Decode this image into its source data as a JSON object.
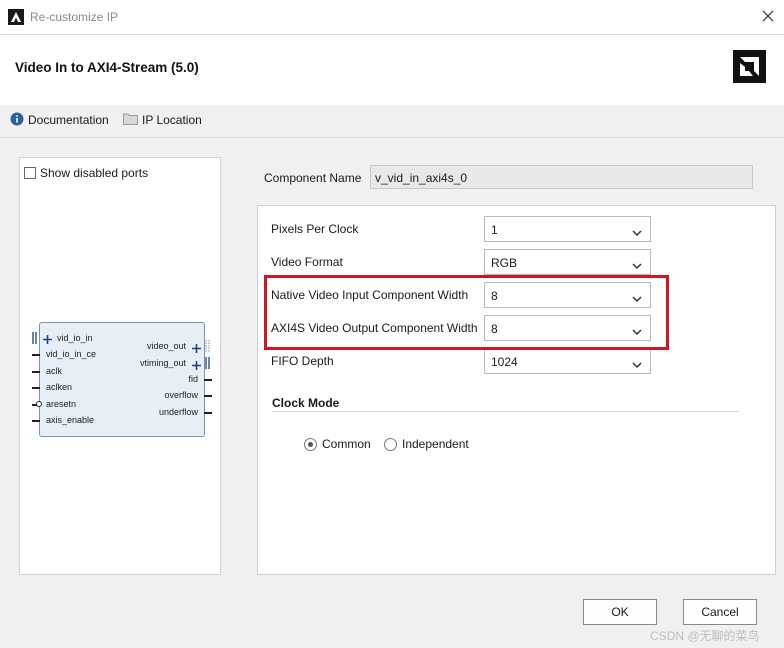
{
  "window": {
    "title": "Re-customize IP",
    "close_symbol": "×"
  },
  "header": {
    "ip_title": "Video In to AXI4-Stream (5.0)"
  },
  "toolbar": {
    "documentation": "Documentation",
    "ip_location": "IP Location"
  },
  "left_panel": {
    "show_disabled_ports": "Show disabled ports",
    "show_disabled_checked": false,
    "block": {
      "left_ports": [
        "vid_io_in",
        "vid_io_in_ce",
        "aclk",
        "aclken",
        "aresetn",
        "axis_enable"
      ],
      "right_ports": [
        "video_out",
        "vtiming_out",
        "fid",
        "overflow",
        "underflow"
      ]
    }
  },
  "component": {
    "label": "Component Name",
    "value": "v_vid_in_axi4s_0"
  },
  "params": [
    {
      "label": "Pixels Per Clock",
      "value": "1"
    },
    {
      "label": "Video Format",
      "value": "RGB"
    },
    {
      "label": "Native Video Input Component Width",
      "value": "8"
    },
    {
      "label": "AXI4S Video Output Component Width",
      "value": "8"
    },
    {
      "label": "FIFO Depth",
      "value": "1024"
    }
  ],
  "clock_mode": {
    "title": "Clock Mode",
    "options": [
      "Common",
      "Independent"
    ],
    "selected": "Common"
  },
  "buttons": {
    "ok": "OK",
    "cancel": "Cancel"
  },
  "watermark": "CSDN @无聊的菜鸟",
  "colors": {
    "highlight": "#d6141f",
    "block_fill": "#e7eef6",
    "block_border": "#7c93ad"
  }
}
